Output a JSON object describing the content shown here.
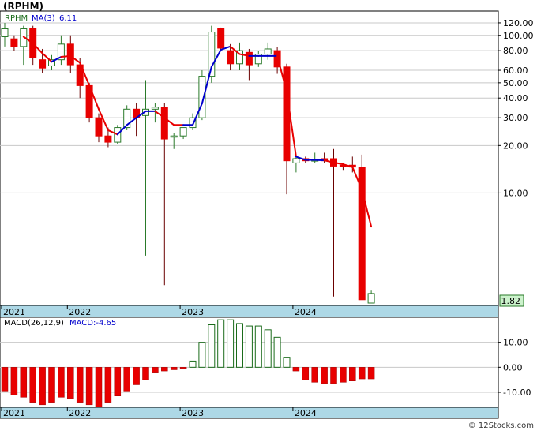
{
  "title": "(RPHM)",
  "footer": "© 12Stocks.com",
  "colors": {
    "up": "#2a7a2a",
    "down": "#e80000",
    "ma_rising": "#0000cc",
    "ma_falling": "#e80000",
    "axis_band": "#add8e6",
    "macd_up": "#1a6b1a",
    "macd_down": "#e80000"
  },
  "chart_data": [
    {
      "type": "candlestick",
      "legend": {
        "symbol": "RPHM",
        "ma_label": "MA(3)",
        "ma_value": "6.11"
      },
      "y_scale": "log",
      "ylim": [
        2.0,
        130
      ],
      "y_ticks": [
        "120.00",
        "100.00",
        "80.00",
        "60.00",
        "50.00",
        "40.00",
        "30.00",
        "20.00",
        "10.00"
      ],
      "last_price_label": "1.82",
      "x_labels": [
        "2021",
        "2022",
        "2023",
        "2024"
      ],
      "x_label_index": [
        0,
        7,
        19,
        31
      ],
      "candles": [
        {
          "o": 98,
          "h": 120,
          "l": 85,
          "c": 110
        },
        {
          "o": 95,
          "h": 100,
          "l": 80,
          "c": 85
        },
        {
          "o": 85,
          "h": 115,
          "l": 65,
          "c": 110
        },
        {
          "o": 110,
          "h": 115,
          "l": 65,
          "c": 72
        },
        {
          "o": 70,
          "h": 82,
          "l": 58,
          "c": 62
        },
        {
          "o": 64,
          "h": 75,
          "l": 60,
          "c": 70
        },
        {
          "o": 70,
          "h": 100,
          "l": 65,
          "c": 88
        },
        {
          "o": 88,
          "h": 100,
          "l": 58,
          "c": 65
        },
        {
          "o": 65,
          "h": 72,
          "l": 40,
          "c": 48
        },
        {
          "o": 48,
          "h": 50,
          "l": 28,
          "c": 30
        },
        {
          "o": 30,
          "h": 32,
          "l": 21,
          "c": 23
        },
        {
          "o": 23,
          "h": 26,
          "l": 19.5,
          "c": 21
        },
        {
          "o": 21,
          "h": 27,
          "l": 20.5,
          "c": 26
        },
        {
          "o": 26,
          "h": 36,
          "l": 25,
          "c": 34
        },
        {
          "o": 34,
          "h": 37,
          "l": 23,
          "c": 30
        },
        {
          "o": 31,
          "h": 52,
          "l": 4.0,
          "c": 34
        },
        {
          "o": 34,
          "h": 37,
          "l": 28,
          "c": 35
        },
        {
          "o": 35,
          "h": 37,
          "l": 2.6,
          "c": 22
        },
        {
          "o": 23,
          "h": 24,
          "l": 19,
          "c": 23
        },
        {
          "o": 23,
          "h": 26,
          "l": 22,
          "c": 26
        },
        {
          "o": 26,
          "h": 32,
          "l": 25,
          "c": 30
        },
        {
          "o": 30,
          "h": 60,
          "l": 29,
          "c": 55
        },
        {
          "o": 55,
          "h": 115,
          "l": 50,
          "c": 105
        },
        {
          "o": 110,
          "h": 112,
          "l": 80,
          "c": 83
        },
        {
          "o": 80,
          "h": 88,
          "l": 60,
          "c": 66
        },
        {
          "o": 66,
          "h": 90,
          "l": 60,
          "c": 80
        },
        {
          "o": 78,
          "h": 82,
          "l": 52,
          "c": 65
        },
        {
          "o": 66,
          "h": 80,
          "l": 63,
          "c": 76
        },
        {
          "o": 76,
          "h": 90,
          "l": 70,
          "c": 82
        },
        {
          "o": 80,
          "h": 84,
          "l": 57,
          "c": 63
        },
        {
          "o": 63,
          "h": 66,
          "l": 9.8,
          "c": 16
        },
        {
          "o": 15.5,
          "h": 17,
          "l": 13.5,
          "c": 16.5
        },
        {
          "o": 16.5,
          "h": 17,
          "l": 15.5,
          "c": 16
        },
        {
          "o": 16,
          "h": 18,
          "l": 15.5,
          "c": 16.2
        },
        {
          "o": 16.5,
          "h": 18,
          "l": 15.5,
          "c": 16
        },
        {
          "o": 16.5,
          "h": 19,
          "l": 2.2,
          "c": 14.8
        },
        {
          "o": 15,
          "h": 15.5,
          "l": 14,
          "c": 14.8
        },
        {
          "o": 15,
          "h": 17,
          "l": 13.5,
          "c": 14.6
        },
        {
          "o": 14.5,
          "h": 17.5,
          "l": 2.2,
          "c": 2.1
        },
        {
          "o": 2.0,
          "h": 2.4,
          "l": 2.0,
          "c": 2.3
        }
      ],
      "ma": [
        null,
        null,
        98,
        89,
        77,
        68,
        73,
        74,
        67,
        48,
        34,
        25,
        23.5,
        27,
        30,
        33,
        33,
        30,
        27,
        27,
        27,
        37,
        63,
        81,
        85,
        76,
        74,
        74,
        74,
        74,
        44,
        17,
        16.2,
        16.2,
        16.1,
        15.6,
        15.2,
        14.6,
        10.5,
        6.11
      ],
      "ma_rising": [
        false,
        false,
        false,
        false,
        false,
        false,
        true,
        false,
        false,
        false,
        false,
        false,
        false,
        true,
        true,
        true,
        true,
        false,
        false,
        false,
        true,
        true,
        true,
        true,
        true,
        false,
        false,
        true,
        true,
        true,
        false,
        false,
        true,
        true,
        true,
        false,
        false,
        false,
        false,
        false
      ]
    },
    {
      "type": "bar",
      "legend": {
        "label": "MACD(26,12,9)",
        "macd_label": "MACD:-4.65"
      },
      "ylim": [
        -16,
        20
      ],
      "y_ticks": [
        "10.00",
        "0.00",
        "-10.00"
      ],
      "y_tick_values": [
        10,
        0,
        -10
      ],
      "x_labels": [
        "2021",
        "2022",
        "2023",
        "2024"
      ],
      "x_label_index": [
        0,
        7,
        19,
        31
      ],
      "values": [
        -9.5,
        -11,
        -12,
        -14,
        -15,
        -14,
        -12,
        -12.5,
        -14,
        -15,
        -16,
        -14,
        -11.5,
        -9.5,
        -7,
        -5,
        -2,
        -1.5,
        -1,
        -0.5,
        2.5,
        10,
        17,
        19,
        19,
        17.5,
        16.5,
        16.5,
        15,
        12,
        4,
        -1.5,
        -5,
        -6,
        -6.5,
        -6.5,
        -6,
        -5.5,
        -4.65,
        -4.65
      ]
    }
  ]
}
